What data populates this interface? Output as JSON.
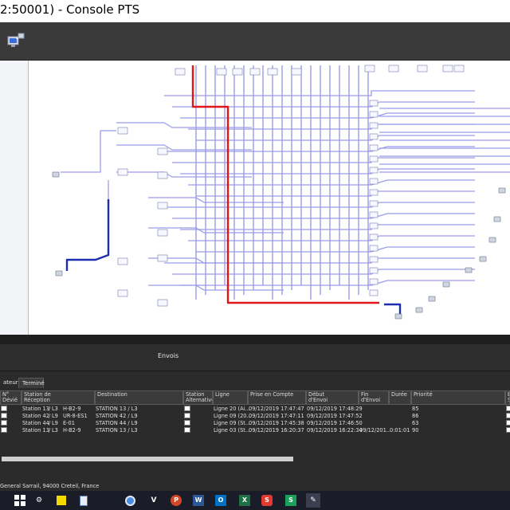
{
  "window": {
    "title": "2:50001) - Console PTS"
  },
  "toolbar": {
    "network_icon": "network-monitor-icon"
  },
  "panel": {
    "title": "Envois",
    "tabs": [
      {
        "label": "ateur"
      },
      {
        "label": "Terminé"
      }
    ]
  },
  "table": {
    "columns": [
      "N° Dévié",
      "Station de\nRéception",
      "Destination",
      "Station\nAlternative",
      "Ligne",
      "Prise en Compte",
      "Début\nd'Envoi",
      "Fin\nd'Envoi",
      "Durée",
      "Priorité",
      "E\nS"
    ],
    "rows": [
      {
        "station": "Station 13",
        "line_code": "L3",
        "code": "H-B2-9",
        "destination": "STATION 13 / L3",
        "ligne": "Ligne 20 (Ai...",
        "prise": "09/12/2019 17:47:47",
        "debut": "09/12/2019 17:48:29",
        "fin": "",
        "duree": "",
        "priorite": "85"
      },
      {
        "station": "Station 42",
        "line_code": "L9",
        "code": "UR-8-ES1",
        "destination": "STATION 42 / L9",
        "ligne": "Ligne 09 (20...",
        "prise": "09/12/2019 17:47:11",
        "debut": "09/12/2019 17:47:52",
        "fin": "",
        "duree": "",
        "priorite": "86"
      },
      {
        "station": "Station 44",
        "line_code": "L9",
        "code": "E-01",
        "destination": "STATION 44 / L9",
        "ligne": "Ligne 09 (St...",
        "prise": "09/12/2019 17:45:38",
        "debut": "09/12/2019 17:46:50",
        "fin": "",
        "duree": "",
        "priorite": "63"
      },
      {
        "station": "Station 13",
        "line_code": "L3",
        "code": "H-B2-9",
        "destination": "STATION 13 / L3",
        "ligne": "Ligne 03 (St...",
        "prise": "09/12/2019 16:20:37",
        "debut": "09/12/2019 16:22:34",
        "fin": "09/12/201...",
        "duree": "0:01:01",
        "priorite": "90"
      }
    ]
  },
  "status": {
    "address": "General Sarrail, 94000 Creteil, France"
  },
  "taskbar": {
    "icons": [
      "windows-start-icon",
      "settings-icon",
      "sticky-notes-icon",
      "document-icon",
      "browser-icon",
      "vpn-icon",
      "powerpoint-icon",
      "word-icon",
      "outlook-icon",
      "excel-icon",
      "snagit-icon",
      "app-icon",
      "pen-tool-icon"
    ]
  },
  "colors": {
    "wire": "#9a9ce8",
    "highlight": "#e0161b",
    "active": "#1c2db0",
    "canvas": "#ffffff"
  }
}
